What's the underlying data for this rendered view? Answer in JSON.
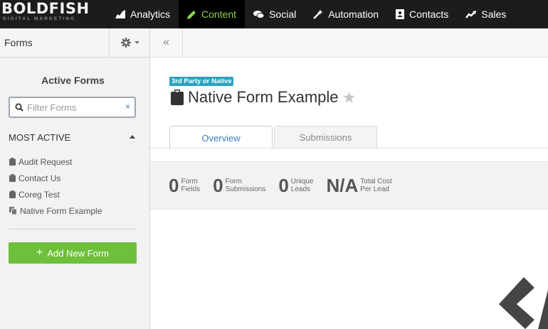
{
  "brand": {
    "name": "BOLDFISH",
    "tagline": "DIGITAL MARKETING"
  },
  "nav": [
    {
      "label": "Analytics",
      "icon": "chart-icon"
    },
    {
      "label": "Content",
      "icon": "pencil-icon",
      "active": true
    },
    {
      "label": "Social",
      "icon": "chat-bubbles-icon"
    },
    {
      "label": "Automation",
      "icon": "magic-wand-icon"
    },
    {
      "label": "Contacts",
      "icon": "address-book-icon"
    },
    {
      "label": "Sales",
      "icon": "trend-up-icon"
    }
  ],
  "colors": {
    "accent_green": "#6ec03b",
    "active_nav": "#8fd14f",
    "badge": "#29a2bf",
    "link_blue": "#3a7ebf"
  },
  "sidebar": {
    "title": "Forms",
    "heading": "Active Forms",
    "filter_placeholder": "Filter Forms",
    "filter_clear": "×",
    "section": "MOST ACTIVE",
    "items": [
      {
        "label": "Audit Request",
        "icon": "clipboard-icon"
      },
      {
        "label": "Contact Us",
        "icon": "clipboard-icon"
      },
      {
        "label": "Coreg Test",
        "icon": "clipboard-icon"
      },
      {
        "label": "Native Form Example",
        "icon": "copy-icon"
      }
    ],
    "add_button": "Add New Form",
    "add_icon": "+"
  },
  "main": {
    "collapse_icon": "«",
    "badge": "3rd Party or Native",
    "form_title": "Native Form Example",
    "tabs": [
      "Overview",
      "Submissions"
    ],
    "stats": [
      {
        "value": "0",
        "label1": "Form",
        "label2": "Fields"
      },
      {
        "value": "0",
        "label1": "Form",
        "label2": "Submissions"
      },
      {
        "value": "0",
        "label1": "Unique",
        "label2": "Leads"
      },
      {
        "value": "N/A",
        "label1": "Total Cost",
        "label2": "Per Lead"
      }
    ]
  }
}
